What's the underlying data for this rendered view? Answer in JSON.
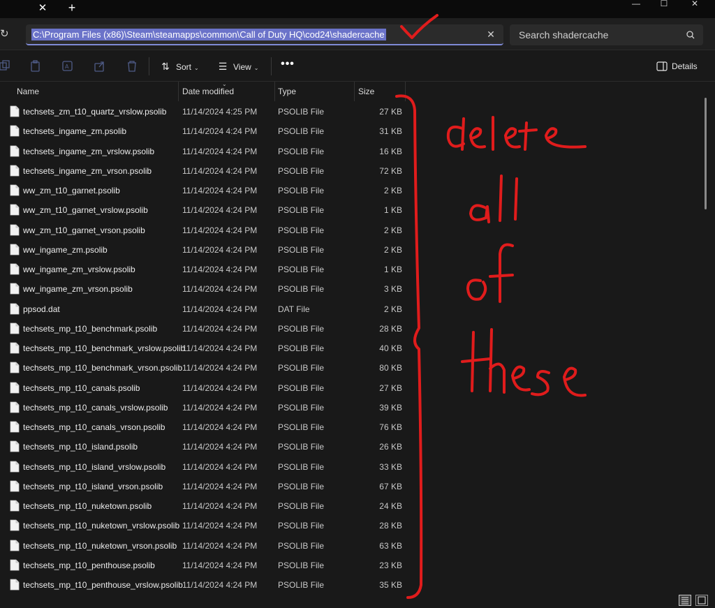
{
  "address_bar": {
    "path": "C:\\Program Files (x86)\\Steam\\steamapps\\common\\Call of Duty HQ\\cod24\\shadercache"
  },
  "search": {
    "placeholder": "Search shadercache"
  },
  "toolbar": {
    "sort_label": "Sort",
    "view_label": "View",
    "more_label": "•••",
    "details_label": "Details"
  },
  "columns": {
    "name": "Name",
    "date": "Date modified",
    "type": "Type",
    "size": "Size"
  },
  "files": [
    {
      "name": "techsets_zm_t10_quartz_vrslow.psolib",
      "date": "11/14/2024 4:25 PM",
      "type": "PSOLIB File",
      "size": "27 KB"
    },
    {
      "name": "techsets_ingame_zm.psolib",
      "date": "11/14/2024 4:24 PM",
      "type": "PSOLIB File",
      "size": "31 KB"
    },
    {
      "name": "techsets_ingame_zm_vrslow.psolib",
      "date": "11/14/2024 4:24 PM",
      "type": "PSOLIB File",
      "size": "16 KB"
    },
    {
      "name": "techsets_ingame_zm_vrson.psolib",
      "date": "11/14/2024 4:24 PM",
      "type": "PSOLIB File",
      "size": "72 KB"
    },
    {
      "name": "ww_zm_t10_garnet.psolib",
      "date": "11/14/2024 4:24 PM",
      "type": "PSOLIB File",
      "size": "2 KB"
    },
    {
      "name": "ww_zm_t10_garnet_vrslow.psolib",
      "date": "11/14/2024 4:24 PM",
      "type": "PSOLIB File",
      "size": "1 KB"
    },
    {
      "name": "ww_zm_t10_garnet_vrson.psolib",
      "date": "11/14/2024 4:24 PM",
      "type": "PSOLIB File",
      "size": "2 KB"
    },
    {
      "name": "ww_ingame_zm.psolib",
      "date": "11/14/2024 4:24 PM",
      "type": "PSOLIB File",
      "size": "2 KB"
    },
    {
      "name": "ww_ingame_zm_vrslow.psolib",
      "date": "11/14/2024 4:24 PM",
      "type": "PSOLIB File",
      "size": "1 KB"
    },
    {
      "name": "ww_ingame_zm_vrson.psolib",
      "date": "11/14/2024 4:24 PM",
      "type": "PSOLIB File",
      "size": "3 KB"
    },
    {
      "name": "ppsod.dat",
      "date": "11/14/2024 4:24 PM",
      "type": "DAT File",
      "size": "2 KB"
    },
    {
      "name": "techsets_mp_t10_benchmark.psolib",
      "date": "11/14/2024 4:24 PM",
      "type": "PSOLIB File",
      "size": "28 KB"
    },
    {
      "name": "techsets_mp_t10_benchmark_vrslow.psolib",
      "date": "11/14/2024 4:24 PM",
      "type": "PSOLIB File",
      "size": "40 KB"
    },
    {
      "name": "techsets_mp_t10_benchmark_vrson.psolib",
      "date": "11/14/2024 4:24 PM",
      "type": "PSOLIB File",
      "size": "80 KB"
    },
    {
      "name": "techsets_mp_t10_canals.psolib",
      "date": "11/14/2024 4:24 PM",
      "type": "PSOLIB File",
      "size": "27 KB"
    },
    {
      "name": "techsets_mp_t10_canals_vrslow.psolib",
      "date": "11/14/2024 4:24 PM",
      "type": "PSOLIB File",
      "size": "39 KB"
    },
    {
      "name": "techsets_mp_t10_canals_vrson.psolib",
      "date": "11/14/2024 4:24 PM",
      "type": "PSOLIB File",
      "size": "76 KB"
    },
    {
      "name": "techsets_mp_t10_island.psolib",
      "date": "11/14/2024 4:24 PM",
      "type": "PSOLIB File",
      "size": "26 KB"
    },
    {
      "name": "techsets_mp_t10_island_vrslow.psolib",
      "date": "11/14/2024 4:24 PM",
      "type": "PSOLIB File",
      "size": "33 KB"
    },
    {
      "name": "techsets_mp_t10_island_vrson.psolib",
      "date": "11/14/2024 4:24 PM",
      "type": "PSOLIB File",
      "size": "67 KB"
    },
    {
      "name": "techsets_mp_t10_nuketown.psolib",
      "date": "11/14/2024 4:24 PM",
      "type": "PSOLIB File",
      "size": "24 KB"
    },
    {
      "name": "techsets_mp_t10_nuketown_vrslow.psolib",
      "date": "11/14/2024 4:24 PM",
      "type": "PSOLIB File",
      "size": "28 KB"
    },
    {
      "name": "techsets_mp_t10_nuketown_vrson.psolib",
      "date": "11/14/2024 4:24 PM",
      "type": "PSOLIB File",
      "size": "63 KB"
    },
    {
      "name": "techsets_mp_t10_penthouse.psolib",
      "date": "11/14/2024 4:24 PM",
      "type": "PSOLIB File",
      "size": "23 KB"
    },
    {
      "name": "techsets_mp_t10_penthouse_vrslow.psolib",
      "date": "11/14/2024 4:24 PM",
      "type": "PSOLIB File",
      "size": "35 KB"
    }
  ],
  "annotation": {
    "handwritten_text": "delete all of these",
    "color": "#e01c1c"
  },
  "colors": {
    "background": "#191919",
    "selection": "#6b73c9",
    "annotation": "#e01c1c"
  }
}
